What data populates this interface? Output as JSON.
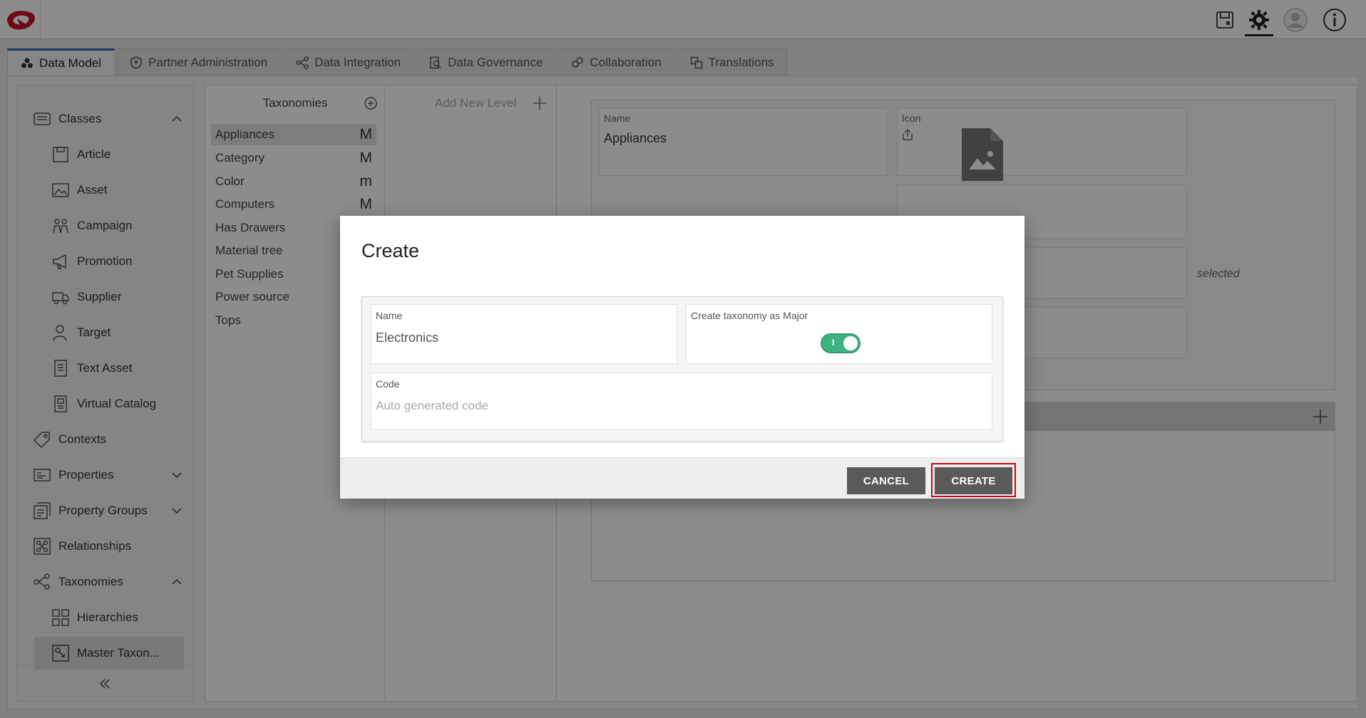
{
  "tabs": [
    {
      "label": "Data Model",
      "icon": "data-model-icon"
    },
    {
      "label": "Partner Administration",
      "icon": "shield-icon"
    },
    {
      "label": "Data Integration",
      "icon": "integration-icon"
    },
    {
      "label": "Data Governance",
      "icon": "governance-icon"
    },
    {
      "label": "Collaboration",
      "icon": "collaboration-icon"
    },
    {
      "label": "Translations",
      "icon": "translations-icon"
    }
  ],
  "sidebar": {
    "items": [
      {
        "label": "Classes"
      },
      {
        "label": "Article"
      },
      {
        "label": "Asset"
      },
      {
        "label": "Campaign"
      },
      {
        "label": "Promotion"
      },
      {
        "label": "Supplier"
      },
      {
        "label": "Target"
      },
      {
        "label": "Text Asset"
      },
      {
        "label": "Virtual Catalog"
      },
      {
        "label": "Contexts"
      },
      {
        "label": "Properties"
      },
      {
        "label": "Property Groups"
      },
      {
        "label": "Relationships"
      },
      {
        "label": "Taxonomies"
      },
      {
        "label": "Hierarchies"
      },
      {
        "label": "Master Taxon..."
      }
    ]
  },
  "taxonomies": {
    "title": "Taxonomies",
    "rows": [
      {
        "label": "Appliances",
        "mark": "M"
      },
      {
        "label": "Category",
        "mark": "M"
      },
      {
        "label": "Color",
        "mark": "m"
      },
      {
        "label": "Computers",
        "mark": "M"
      },
      {
        "label": "Has Drawers",
        "mark": ""
      },
      {
        "label": "Material tree",
        "mark": ""
      },
      {
        "label": "Pet Supplies",
        "mark": ""
      },
      {
        "label": "Power source",
        "mark": ""
      },
      {
        "label": "Tops",
        "mark": ""
      }
    ],
    "add_level": "Add New Level"
  },
  "details": {
    "name_label": "Name",
    "name_value": "Appliances",
    "icon_label": "Icon",
    "selected_text": "selected"
  },
  "modal": {
    "title": "Create",
    "name_label": "Name",
    "name_value": "Electronics",
    "major_label": "Create taxonomy as Major",
    "toggle_on_text": "I",
    "code_label": "Code",
    "code_placeholder": "Auto generated code",
    "cancel_label": "CANCEL",
    "create_label": "CREATE"
  },
  "colors": {
    "accent": "#2a63a8",
    "toggle": "#3fb37f",
    "highlight": "#d0021b",
    "logo": "#c8102e"
  }
}
